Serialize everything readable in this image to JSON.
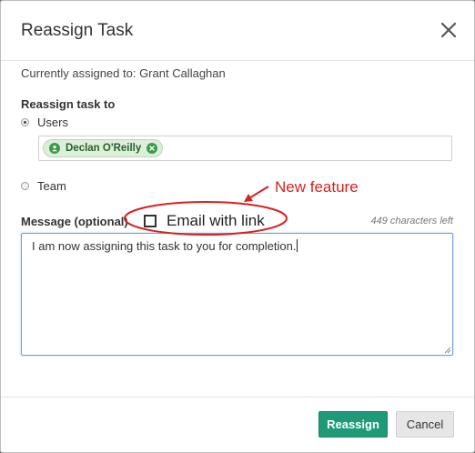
{
  "dialog": {
    "title": "Reassign Task",
    "close_icon": "close-icon"
  },
  "assignment": {
    "current_label": "Currently assigned to: Grant Callaghan",
    "reassign_label": "Reassign task to",
    "options": [
      {
        "label": "Users",
        "selected": true
      },
      {
        "label": "Team",
        "selected": false
      }
    ],
    "selected_user": "Declan O'Reilly",
    "user_icon": "user-icon",
    "remove_icon": "remove-icon"
  },
  "annotation": {
    "text": "New feature",
    "color": "#d62222"
  },
  "message": {
    "label": "Message (optional)",
    "email_link_label": "Email with link",
    "email_link_checked": false,
    "chars_left": "449 characters left",
    "value": "I am now assigning this task to you for completion."
  },
  "footer": {
    "reassign_label": "Reassign",
    "cancel_label": "Cancel"
  },
  "colors": {
    "primary": "#1f9a78",
    "tag_bg": "#dcefd9",
    "focus_border": "#6fa3d8"
  }
}
